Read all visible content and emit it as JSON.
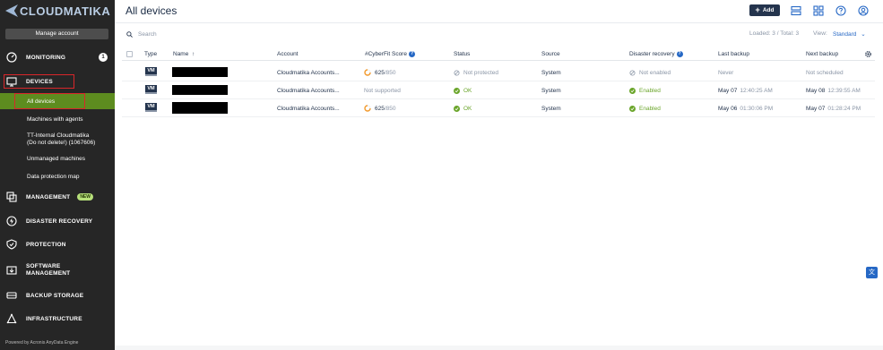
{
  "app": {
    "logo_text": "CLOUDMATIKA"
  },
  "sidebar": {
    "manage_account": "Manage account",
    "monitoring": {
      "label": "MONITORING",
      "count": "1"
    },
    "devices": {
      "label": "DEVICES"
    },
    "sub_items": [
      {
        "label": "All devices"
      },
      {
        "label": "Machines with agents"
      },
      {
        "label": "TT-Internal Cloudmatika"
      },
      {
        "label": "(Do not delete!) (1067606)"
      },
      {
        "label": "Unmanaged machines"
      },
      {
        "label": "Data protection map"
      }
    ],
    "management": {
      "label": "MANAGEMENT",
      "badge": "NEW"
    },
    "disaster_recovery": {
      "label": "DISASTER RECOVERY"
    },
    "protection": {
      "label": "PROTECTION"
    },
    "software_management": {
      "label_line1": "SOFTWARE",
      "label_line2": "MANAGEMENT"
    },
    "backup_storage": {
      "label": "BACKUP STORAGE"
    },
    "infrastructure": {
      "label": "INFRASTRUCTURE"
    },
    "powered_by": "Powered by Acronis AnyData Engine"
  },
  "header": {
    "title": "All devices",
    "add_label": "Add"
  },
  "toolbar": {
    "search_placeholder": "Search",
    "loaded": "Loaded: 3 / Total: 3",
    "view_label": "View:",
    "view_value": "Standard"
  },
  "table": {
    "columns": {
      "type": "Type",
      "name": "Name",
      "account": "Account",
      "cyberfit": "#CyberFit Score",
      "status": "Status",
      "source": "Source",
      "dr": "Disaster recovery",
      "last_backup": "Last backup",
      "next_backup": "Next backup"
    },
    "rows": [
      {
        "type": "VM",
        "account": "Cloudmatika Accounts...",
        "score": "625",
        "score_max": "/850",
        "status": "Not protected",
        "source": "System",
        "dr": "Not enabled",
        "last_backup_date": "Never",
        "last_backup_time": "",
        "next_backup_date": "Not scheduled",
        "next_backup_time": ""
      },
      {
        "type": "VM",
        "account": "Cloudmatika Accounts...",
        "score": "Not supported",
        "score_max": "",
        "status": "OK",
        "source": "System",
        "dr": "Enabled",
        "last_backup_date": "May 07",
        "last_backup_time": "12:40:25 AM",
        "next_backup_date": "May 08",
        "next_backup_time": "12:39:55 AM"
      },
      {
        "type": "VM",
        "account": "Cloudmatika Accounts...",
        "score": "625",
        "score_max": "/850",
        "status": "OK",
        "source": "System",
        "dr": "Enabled",
        "last_backup_date": "May 06",
        "last_backup_time": "01:30:06 PM",
        "next_backup_date": "May 07",
        "next_backup_time": "01:28:24 PM"
      }
    ]
  },
  "colors": {
    "sidebar_bg": "#262626",
    "active_green": "#5d8c1f",
    "highlight_red": "#d9262a",
    "ok_green": "#6aa52a",
    "link_blue": "#2668c5",
    "navy": "#24344d"
  }
}
